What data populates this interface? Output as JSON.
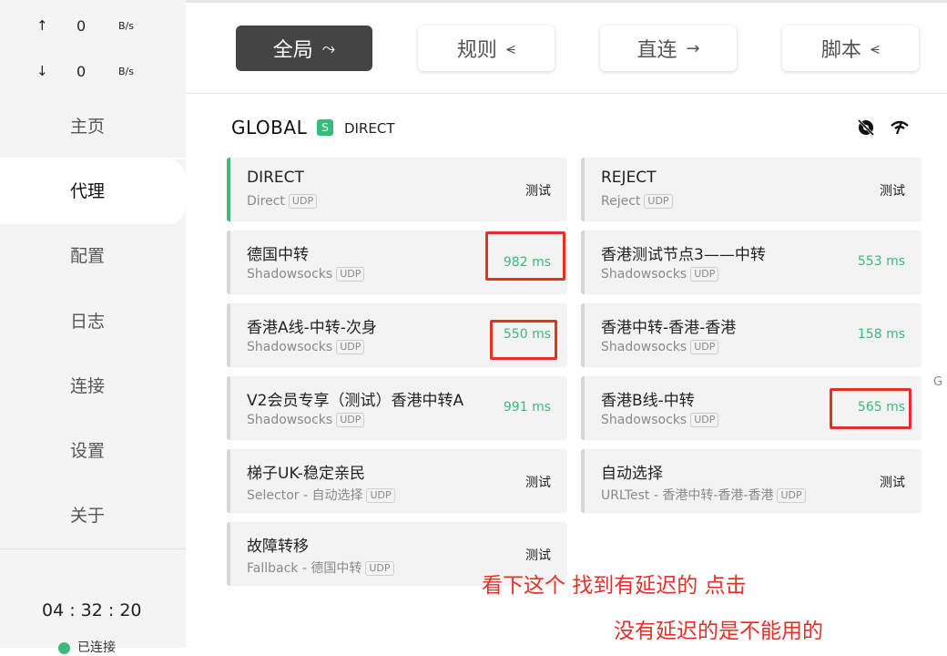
{
  "traffic": {
    "up": {
      "arrow": "↑",
      "value": "0",
      "unit": "B/s"
    },
    "down": {
      "arrow": "↓",
      "value": "0",
      "unit": "B/s"
    }
  },
  "nav": [
    "主页",
    "代理",
    "配置",
    "日志",
    "连接",
    "设置",
    "关于"
  ],
  "clock": "04 : 32 : 20",
  "status": "已连接",
  "modes": [
    {
      "label": "全局",
      "icon": "⤳"
    },
    {
      "label": "规则",
      "icon": "⪪"
    },
    {
      "label": "直连",
      "icon": "→"
    },
    {
      "label": "脚本",
      "icon": "⪪"
    }
  ],
  "group": {
    "name": "GLOBAL",
    "badge": "S",
    "now": "DIRECT"
  },
  "proxies": [
    {
      "name": "DIRECT",
      "type": "Direct",
      "udp": "UDP",
      "delay": "测试"
    },
    {
      "name": "REJECT",
      "type": "Reject",
      "udp": "UDP",
      "delay": "测试"
    },
    {
      "name": "德国中转",
      "type": "Shadowsocks",
      "udp": "UDP",
      "delay": "982 ms"
    },
    {
      "name": "香港测试节点3——中转",
      "type": "Shadowsocks",
      "udp": "UDP",
      "delay": "553 ms"
    },
    {
      "name": "香港A线-中转-次身",
      "type": "Shadowsocks",
      "udp": "UDP",
      "delay": "550 ms"
    },
    {
      "name": "香港中转-香港-香港",
      "type": "Shadowsocks",
      "udp": "UDP",
      "delay": "158 ms"
    },
    {
      "name": "V2会员专享（测试）香港中转A",
      "type": "Shadowsocks",
      "udp": "UDP",
      "delay": "991 ms"
    },
    {
      "name": "香港B线-中转",
      "type": "Shadowsocks",
      "udp": "UDP",
      "delay": "565 ms"
    },
    {
      "name": "梯子UK-稳定亲民",
      "type": "Selector - 自动选择",
      "udp": "UDP",
      "delay": "测试"
    },
    {
      "name": "自动选择",
      "type": "URLTest - 香港中转-香港-香港",
      "udp": "UDP",
      "delay": "测试"
    },
    {
      "name": "故障转移",
      "type": "Fallback - 德国中转",
      "udp": "UDP",
      "delay": "测试"
    }
  ],
  "annotations": {
    "line1": "看下这个 找到有延迟的 点击",
    "line2": "没有延迟的是不能用的"
  },
  "edge_letter": "G",
  "colors": {
    "accent": "#3bba7a",
    "annotation": "#e5302a",
    "active_mode": "#444444"
  }
}
